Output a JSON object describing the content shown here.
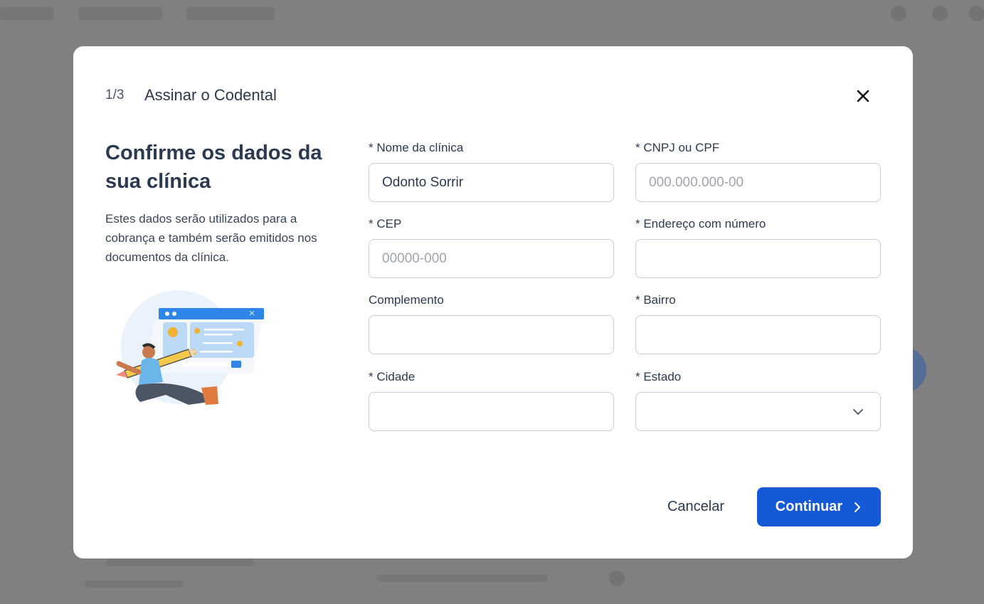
{
  "modal": {
    "step": "1/3",
    "title": "Assinar o Codental",
    "heading": "Confirme os dados da sua clínica",
    "description": "Estes dados serão utilizados para a cobrança e também serão emitidos nos documentos da clínica."
  },
  "form": {
    "clinic_name": {
      "label": "* Nome da clínica",
      "value": "Odonto Sorrir"
    },
    "cnpj_cpf": {
      "label": "* CNPJ ou CPF",
      "placeholder": "000.000.000-00"
    },
    "cep": {
      "label": "* CEP",
      "placeholder": "00000-000"
    },
    "address": {
      "label": "* Endereço com número",
      "value": ""
    },
    "complement": {
      "label": "Complemento",
      "value": ""
    },
    "neighborhood": {
      "label": "* Bairro",
      "value": ""
    },
    "city": {
      "label": "* Cidade",
      "value": ""
    },
    "state": {
      "label": "* Estado",
      "value": ""
    }
  },
  "actions": {
    "cancel": "Cancelar",
    "continue": "Continuar"
  },
  "colors": {
    "primary": "#1559d6",
    "text": "#2c3a4f",
    "border": "#c9cdd4",
    "overlay": "#808080"
  },
  "icons": {
    "close": "close-icon",
    "chevron_down": "chevron-down-icon",
    "chevron_right": "chevron-right-icon"
  }
}
